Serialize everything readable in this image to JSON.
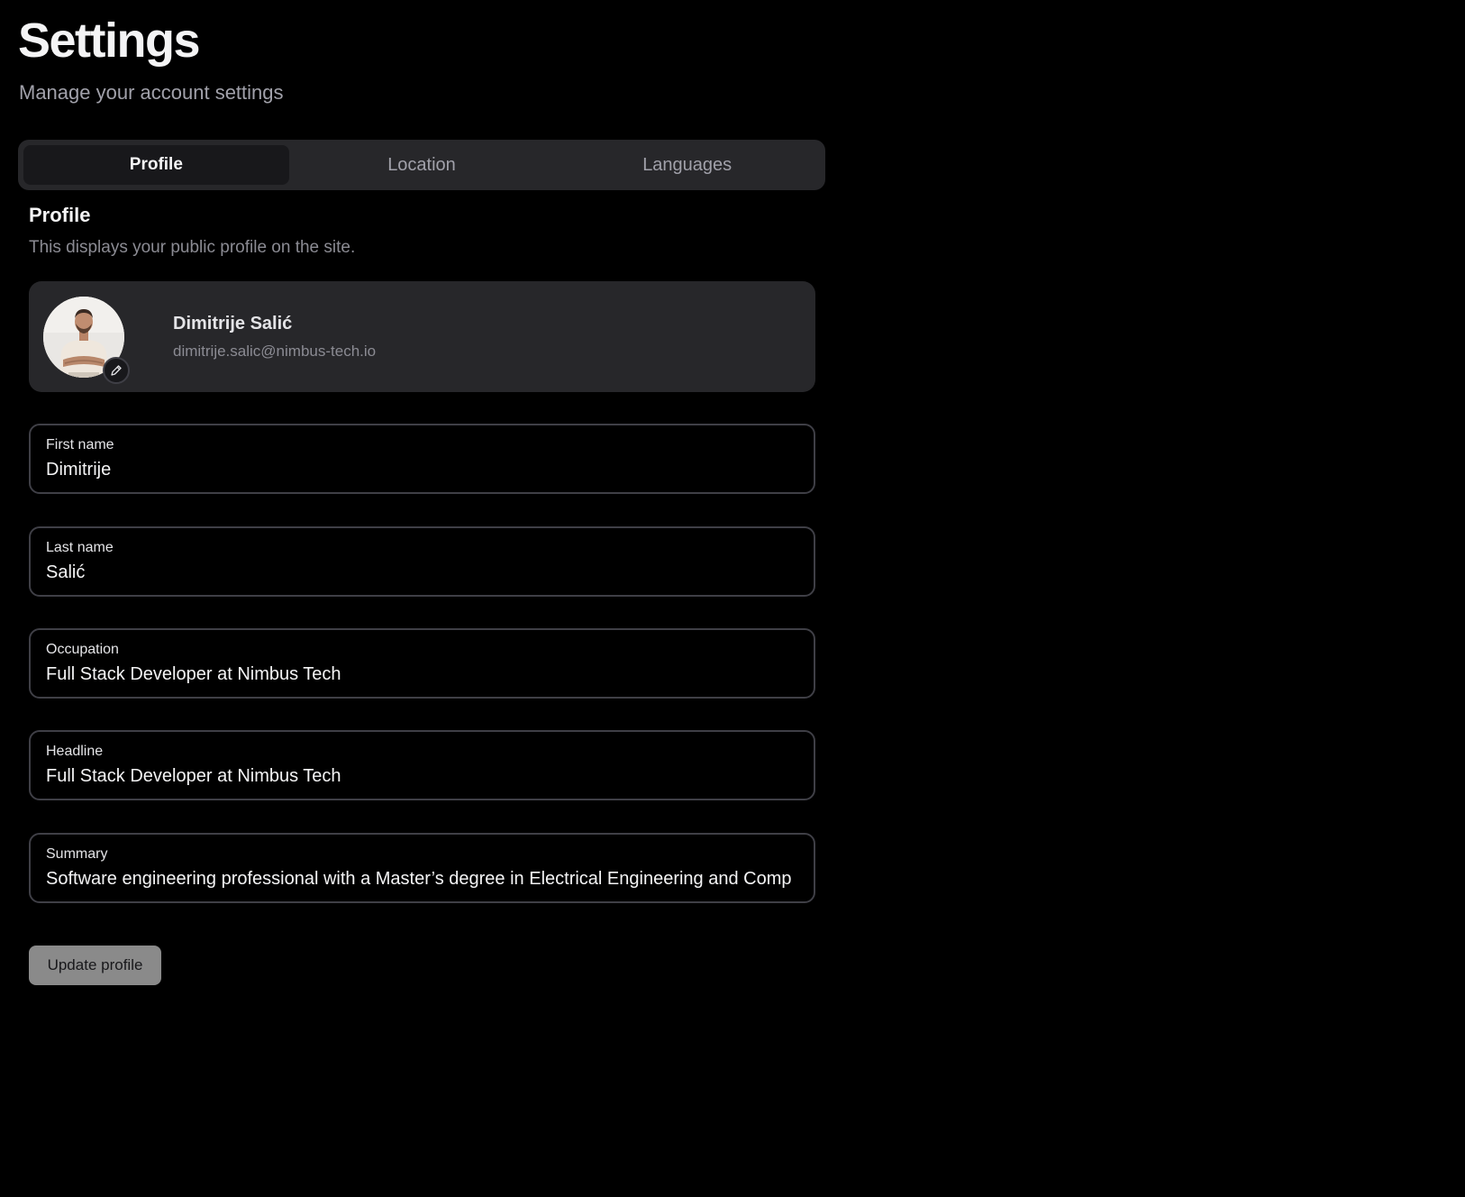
{
  "header": {
    "title": "Settings",
    "subtitle": "Manage your account settings"
  },
  "tabs": [
    {
      "label": "Profile",
      "active": true
    },
    {
      "label": "Location",
      "active": false
    },
    {
      "label": "Languages",
      "active": false
    }
  ],
  "section": {
    "title": "Profile",
    "description": "This displays your public profile on the site."
  },
  "profile_card": {
    "name": "Dimitrije Salić",
    "email": "dimitrije.salic@nimbus-tech.io",
    "avatar_icon": "user-photo",
    "edit_icon": "pencil-icon"
  },
  "fields": {
    "first_name": {
      "label": "First name",
      "value": "Dimitrije"
    },
    "last_name": {
      "label": "Last name",
      "value": "Salić"
    },
    "occupation": {
      "label": "Occupation",
      "value": "Full Stack Developer at Nimbus Tech"
    },
    "headline": {
      "label": "Headline",
      "value": "Full Stack Developer at Nimbus Tech"
    },
    "summary": {
      "label": "Summary",
      "value": "Software engineering professional with a Master’s degree in Electrical Engineering and Comp"
    }
  },
  "actions": {
    "update_label": "Update profile"
  },
  "colors": {
    "background": "#000000",
    "surface": "#27272a",
    "border": "#3f3f46",
    "button": "#8a8a8a"
  }
}
